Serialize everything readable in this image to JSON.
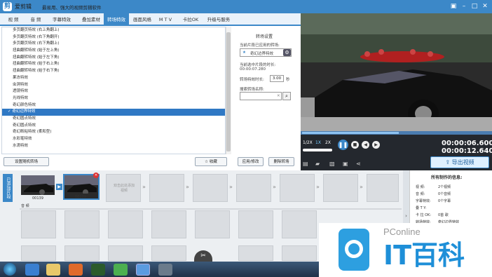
{
  "titlebar": {
    "app_name": "爱剪辑",
    "slogan": "最易用、强大的视频剪辑软件"
  },
  "menu": {
    "tabs": [
      "视 频",
      "音 频",
      "字幕特效",
      "叠加素材",
      "转场特效",
      "画面风格",
      "M T V",
      "卡拉OK",
      "升级与服务"
    ],
    "active": "转场特效"
  },
  "effects": {
    "items": [
      "多页翻页特效 (右上角翻上)",
      "多页翻页特效 (右下角翻开)",
      "多页翻页特效 (右下角翻上)",
      "扭曲翻转特效 (始于左上角)",
      "扭曲翻转特效 (始于左下角)",
      "扭曲翻转特效 (始于右上角)",
      "扭曲翻转特效 (始于右下角)",
      "果冻特效",
      "虫洞特效",
      "透镜特效",
      "光线特效",
      "奇幻颜色特效",
      "奇幻边界特效",
      "奇幻圆点特效",
      "奇幻圆点特效",
      "奇幻断粘特效 (柔和型)",
      "水彩笔特效",
      "水滴特效"
    ],
    "selected_index": 12
  },
  "buttons": {
    "random": "设置随机转场",
    "favorite": "收藏",
    "apply": "应用/修改",
    "delete": "删除转场"
  },
  "settings": {
    "header": "转场设置",
    "current_label": "当前片段已应用的转场:",
    "current_value": "奇幻边界特效",
    "time_label": "当前选中片段的时长:",
    "time_value": "00:00:07.280",
    "duration_label": "转场特效时长:",
    "duration_value": "3.00",
    "duration_unit": "秒",
    "search_label": "搜索转场名称:"
  },
  "player": {
    "speed_half": "1/2X",
    "speed_one": "1X",
    "speed_two": "2X",
    "time_current": "00:00:06.600",
    "time_total": "00:00:12.640",
    "export_label": "导出视频"
  },
  "storyboard": {
    "side_label": "已添加片段",
    "clip_caption": "00139",
    "hint": "双击此处添加视频",
    "audio_label": "音 频"
  },
  "info": {
    "title": "所有制作的信息:",
    "rows": [
      {
        "k": "视 频:",
        "v": "2个视频"
      },
      {
        "k": "音 频:",
        "v": "0个音频"
      },
      {
        "k": "字幕特效:",
        "v": "0个字幕"
      },
      {
        "k": "叠 T Y:",
        "v": ""
      },
      {
        "k": "卡 拉 OK:",
        "v": "0首 歌"
      },
      {
        "k": "转场特效:",
        "v": "奇幻边界特效"
      }
    ]
  },
  "watermark": {
    "brand": "PConline",
    "text": "IT百科"
  }
}
